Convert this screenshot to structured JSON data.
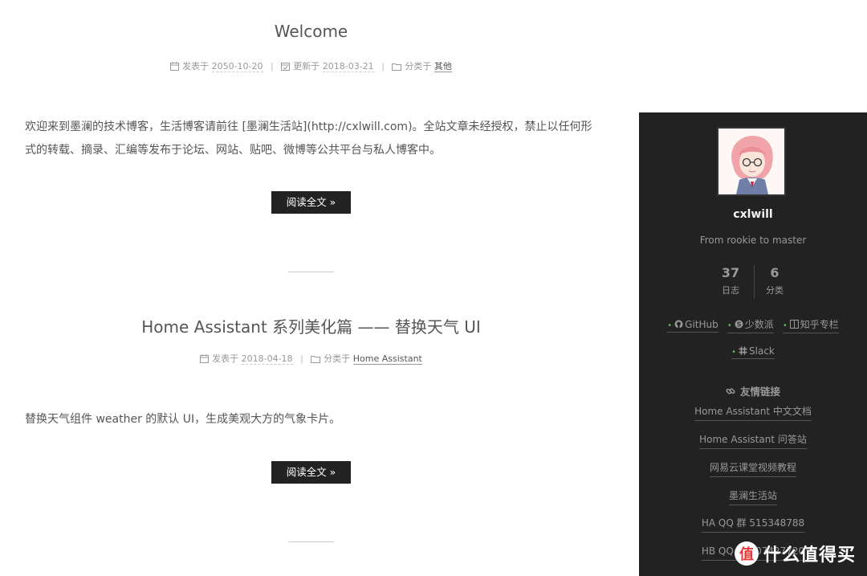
{
  "posts": [
    {
      "title": "Welcome",
      "posted_label": "发表于",
      "posted_date": "2050-10-20",
      "updated_label": "更新于",
      "updated_date": "2018-03-21",
      "category_label": "分类于",
      "category": "其他",
      "excerpt": "欢迎来到墨澜的技术博客，生活博客请前往 [墨澜生活站](http://cxlwill.com)。全站文章未经授权，禁止以任何形式的转载、摘录、汇编等发布于论坛、网站、贴吧、微博等公共平台与私人博客中。",
      "read_more": "阅读全文 »"
    },
    {
      "title": "Home Assistant 系列美化篇 —— 替换天气 UI",
      "posted_label": "发表于",
      "posted_date": "2018-04-18",
      "category_label": "分类于",
      "category": "Home Assistant",
      "excerpt": "替换天气组件 weather 的默认 UI，生成美观大方的气象卡片。",
      "read_more": "阅读全文 »"
    }
  ],
  "sidebar": {
    "name": "cxlwill",
    "description": "From rookie to master",
    "stats": [
      {
        "count": "37",
        "label": "日志"
      },
      {
        "count": "6",
        "label": "分类"
      }
    ],
    "social": [
      {
        "label": "GitHub",
        "icon": "github-icon"
      },
      {
        "label": "少数派",
        "icon": "skype-icon"
      },
      {
        "label": "知乎专栏",
        "icon": "columns-icon"
      },
      {
        "label": "Slack",
        "icon": "slack-icon"
      }
    ],
    "friends_title": "友情链接",
    "friends": [
      "Home Assistant 中文文档",
      "Home Assistant 问答站",
      "网易云课堂视频教程",
      "墨澜生活站",
      "HA QQ 群 515348788",
      "HB QQ 群 707427720"
    ]
  },
  "watermark": {
    "logo_char": "值",
    "text": "什么值得买"
  },
  "colors": {
    "sidebar_bg": "#222222",
    "accent_green": "#55b55e",
    "button_bg": "#222222"
  }
}
